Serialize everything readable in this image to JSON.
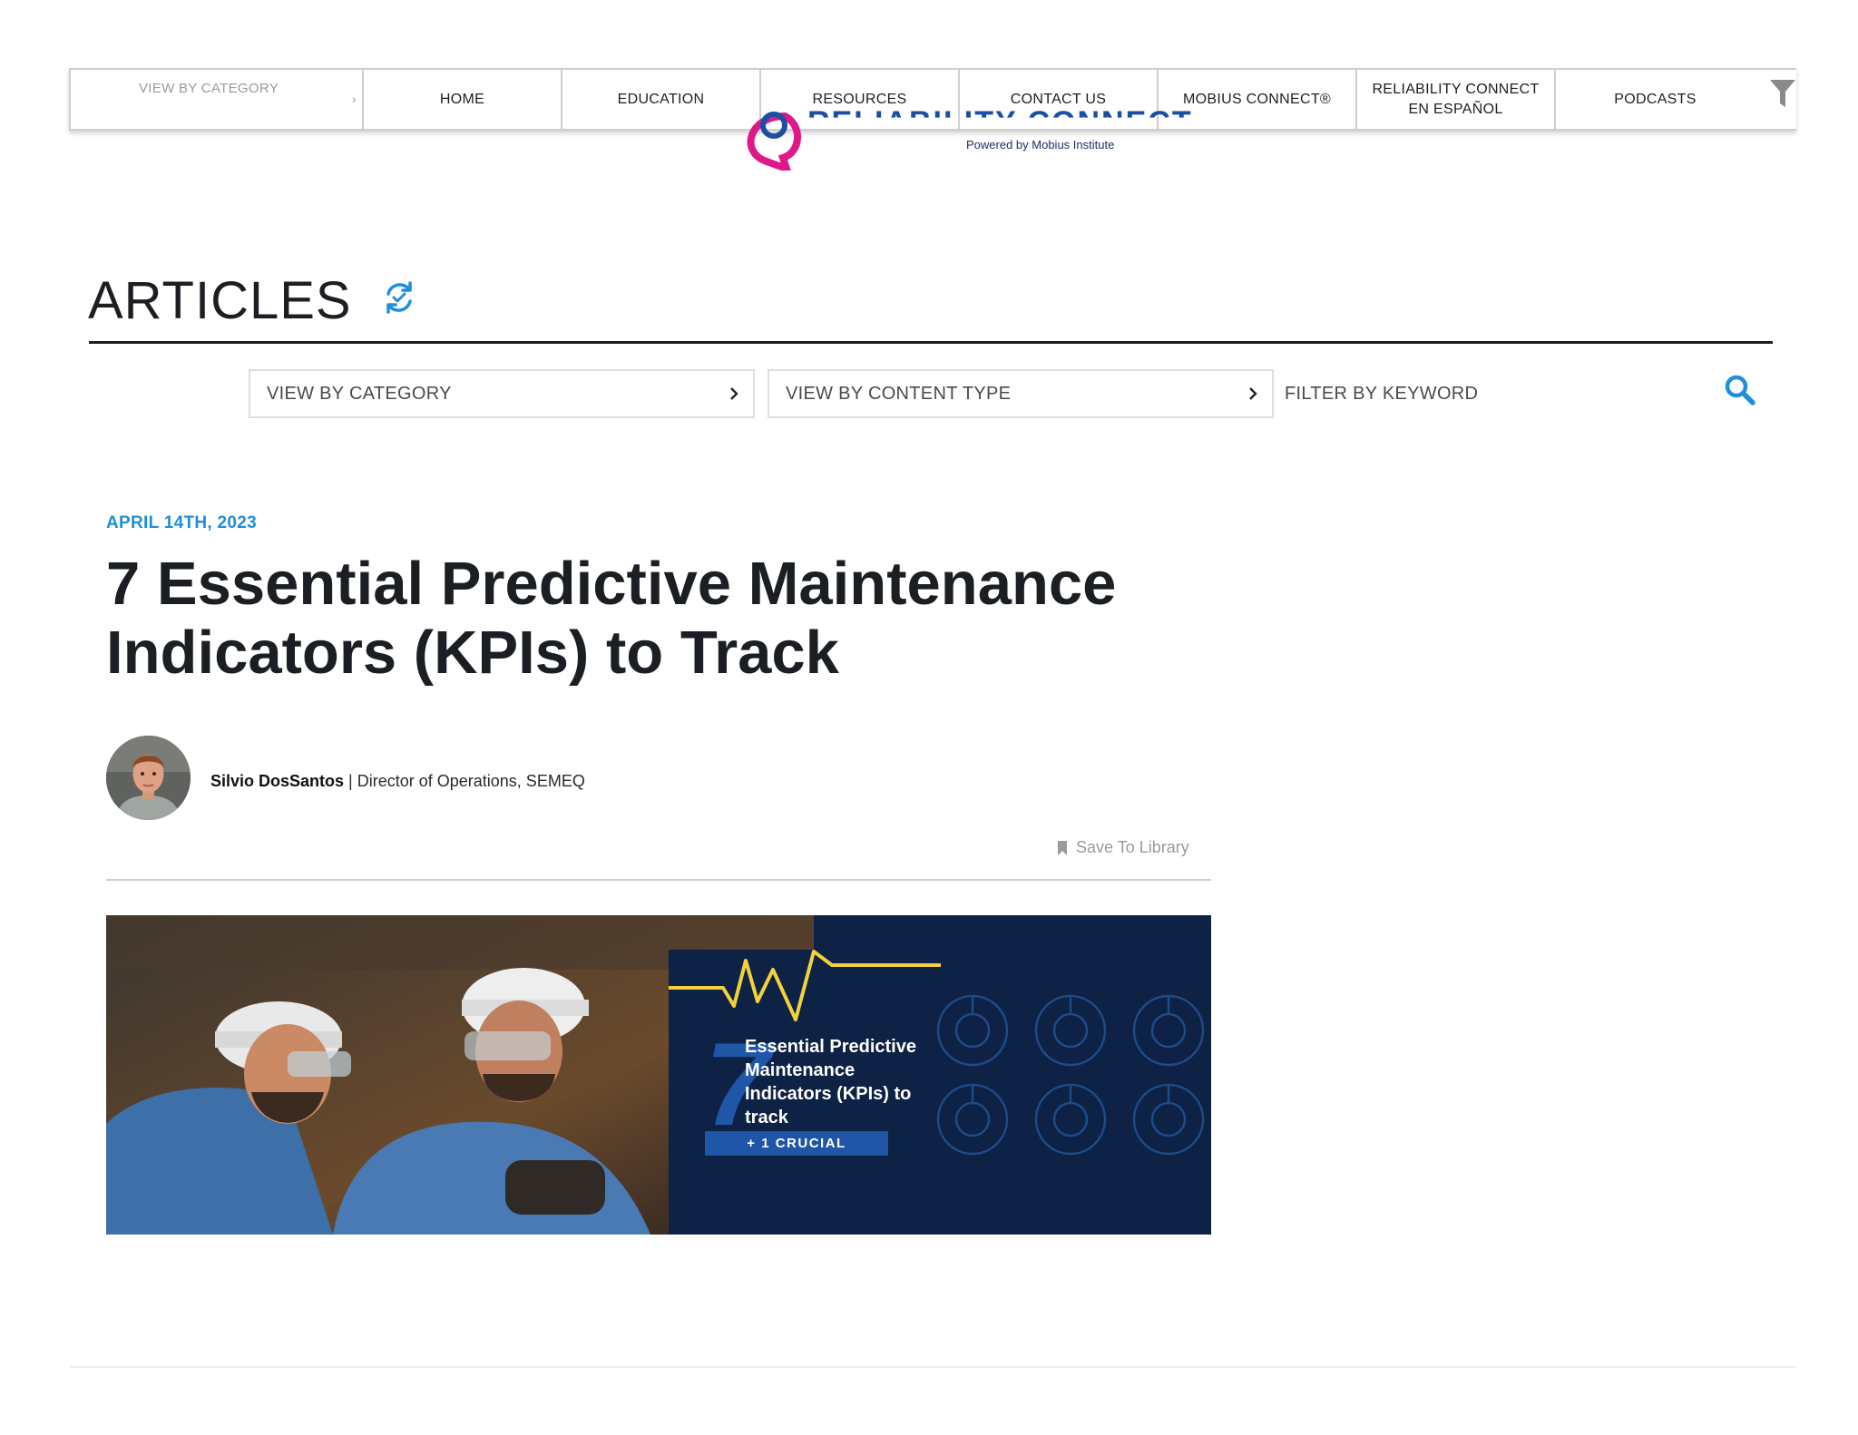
{
  "nav": {
    "category_label": "VIEW BY CATEGORY",
    "items": [
      {
        "label": "HOME"
      },
      {
        "label": "EDUCATION"
      },
      {
        "label": "RESOURCES"
      },
      {
        "label": "CONTACT US"
      },
      {
        "label": "MOBIUS CONNECT®"
      },
      {
        "label": "RELIABILITY CONNECT EN ESPAÑOL"
      },
      {
        "label": "PODCASTS"
      }
    ]
  },
  "logo": {
    "name": "RELIABILITY CONNECT",
    "tagline": "Powered by Mobius Institute"
  },
  "section": {
    "title": "ARTICLES"
  },
  "filters": {
    "category_label": "VIEW BY CATEGORY",
    "content_type_label": "VIEW BY CONTENT TYPE",
    "keyword_placeholder": "FILTER BY KEYWORD"
  },
  "article": {
    "date": "APRIL 14TH, 2023",
    "title": "7 Essential Predictive Maintenance Indicators (KPIs) to Track",
    "author_name": "Silvio DosSantos",
    "author_separator": " | ",
    "author_role": "Director of Operations, SEMEQ",
    "save_label": "Save To Library"
  },
  "hero": {
    "number": "7",
    "text": "Essential Predictive Maintenance Indicators (KPIs) to track",
    "badge": "+ 1 CRUCIAL"
  },
  "colors": {
    "accent_blue": "#1e8fd8",
    "hero_navy": "#0d2244",
    "hero_yellow": "#f2d23c",
    "logo_pink": "#e0198a"
  }
}
